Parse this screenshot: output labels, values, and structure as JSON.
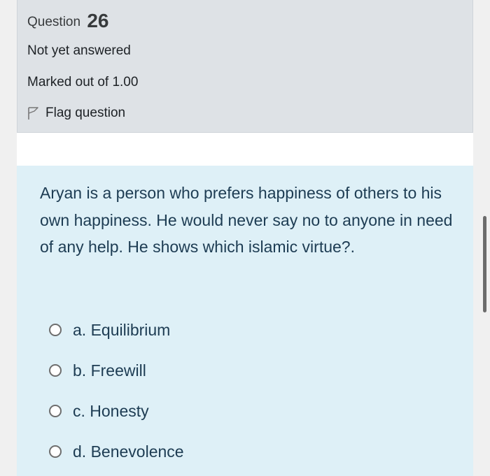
{
  "question": {
    "label": "Question",
    "number": "26",
    "state": "Not yet answered",
    "grade": "Marked out of 1.00",
    "flag_label": "Flag question"
  },
  "qtext": "Aryan is a person who prefers happiness of others to his own happiness. He would never say no to anyone in need of any help. He shows which islamic virtue?.",
  "answers": [
    {
      "letter": "a.",
      "text": "Equilibrium"
    },
    {
      "letter": "b.",
      "text": "Freewill"
    },
    {
      "letter": "c.",
      "text": "Honesty"
    },
    {
      "letter": "d.",
      "text": "Benevolence"
    }
  ],
  "colors": {
    "info_bg": "#dee2e6",
    "content_bg": "#def0f7",
    "text": "#1d3c53"
  },
  "icons": {
    "flag": "flag-icon",
    "radio": "radio-button"
  }
}
